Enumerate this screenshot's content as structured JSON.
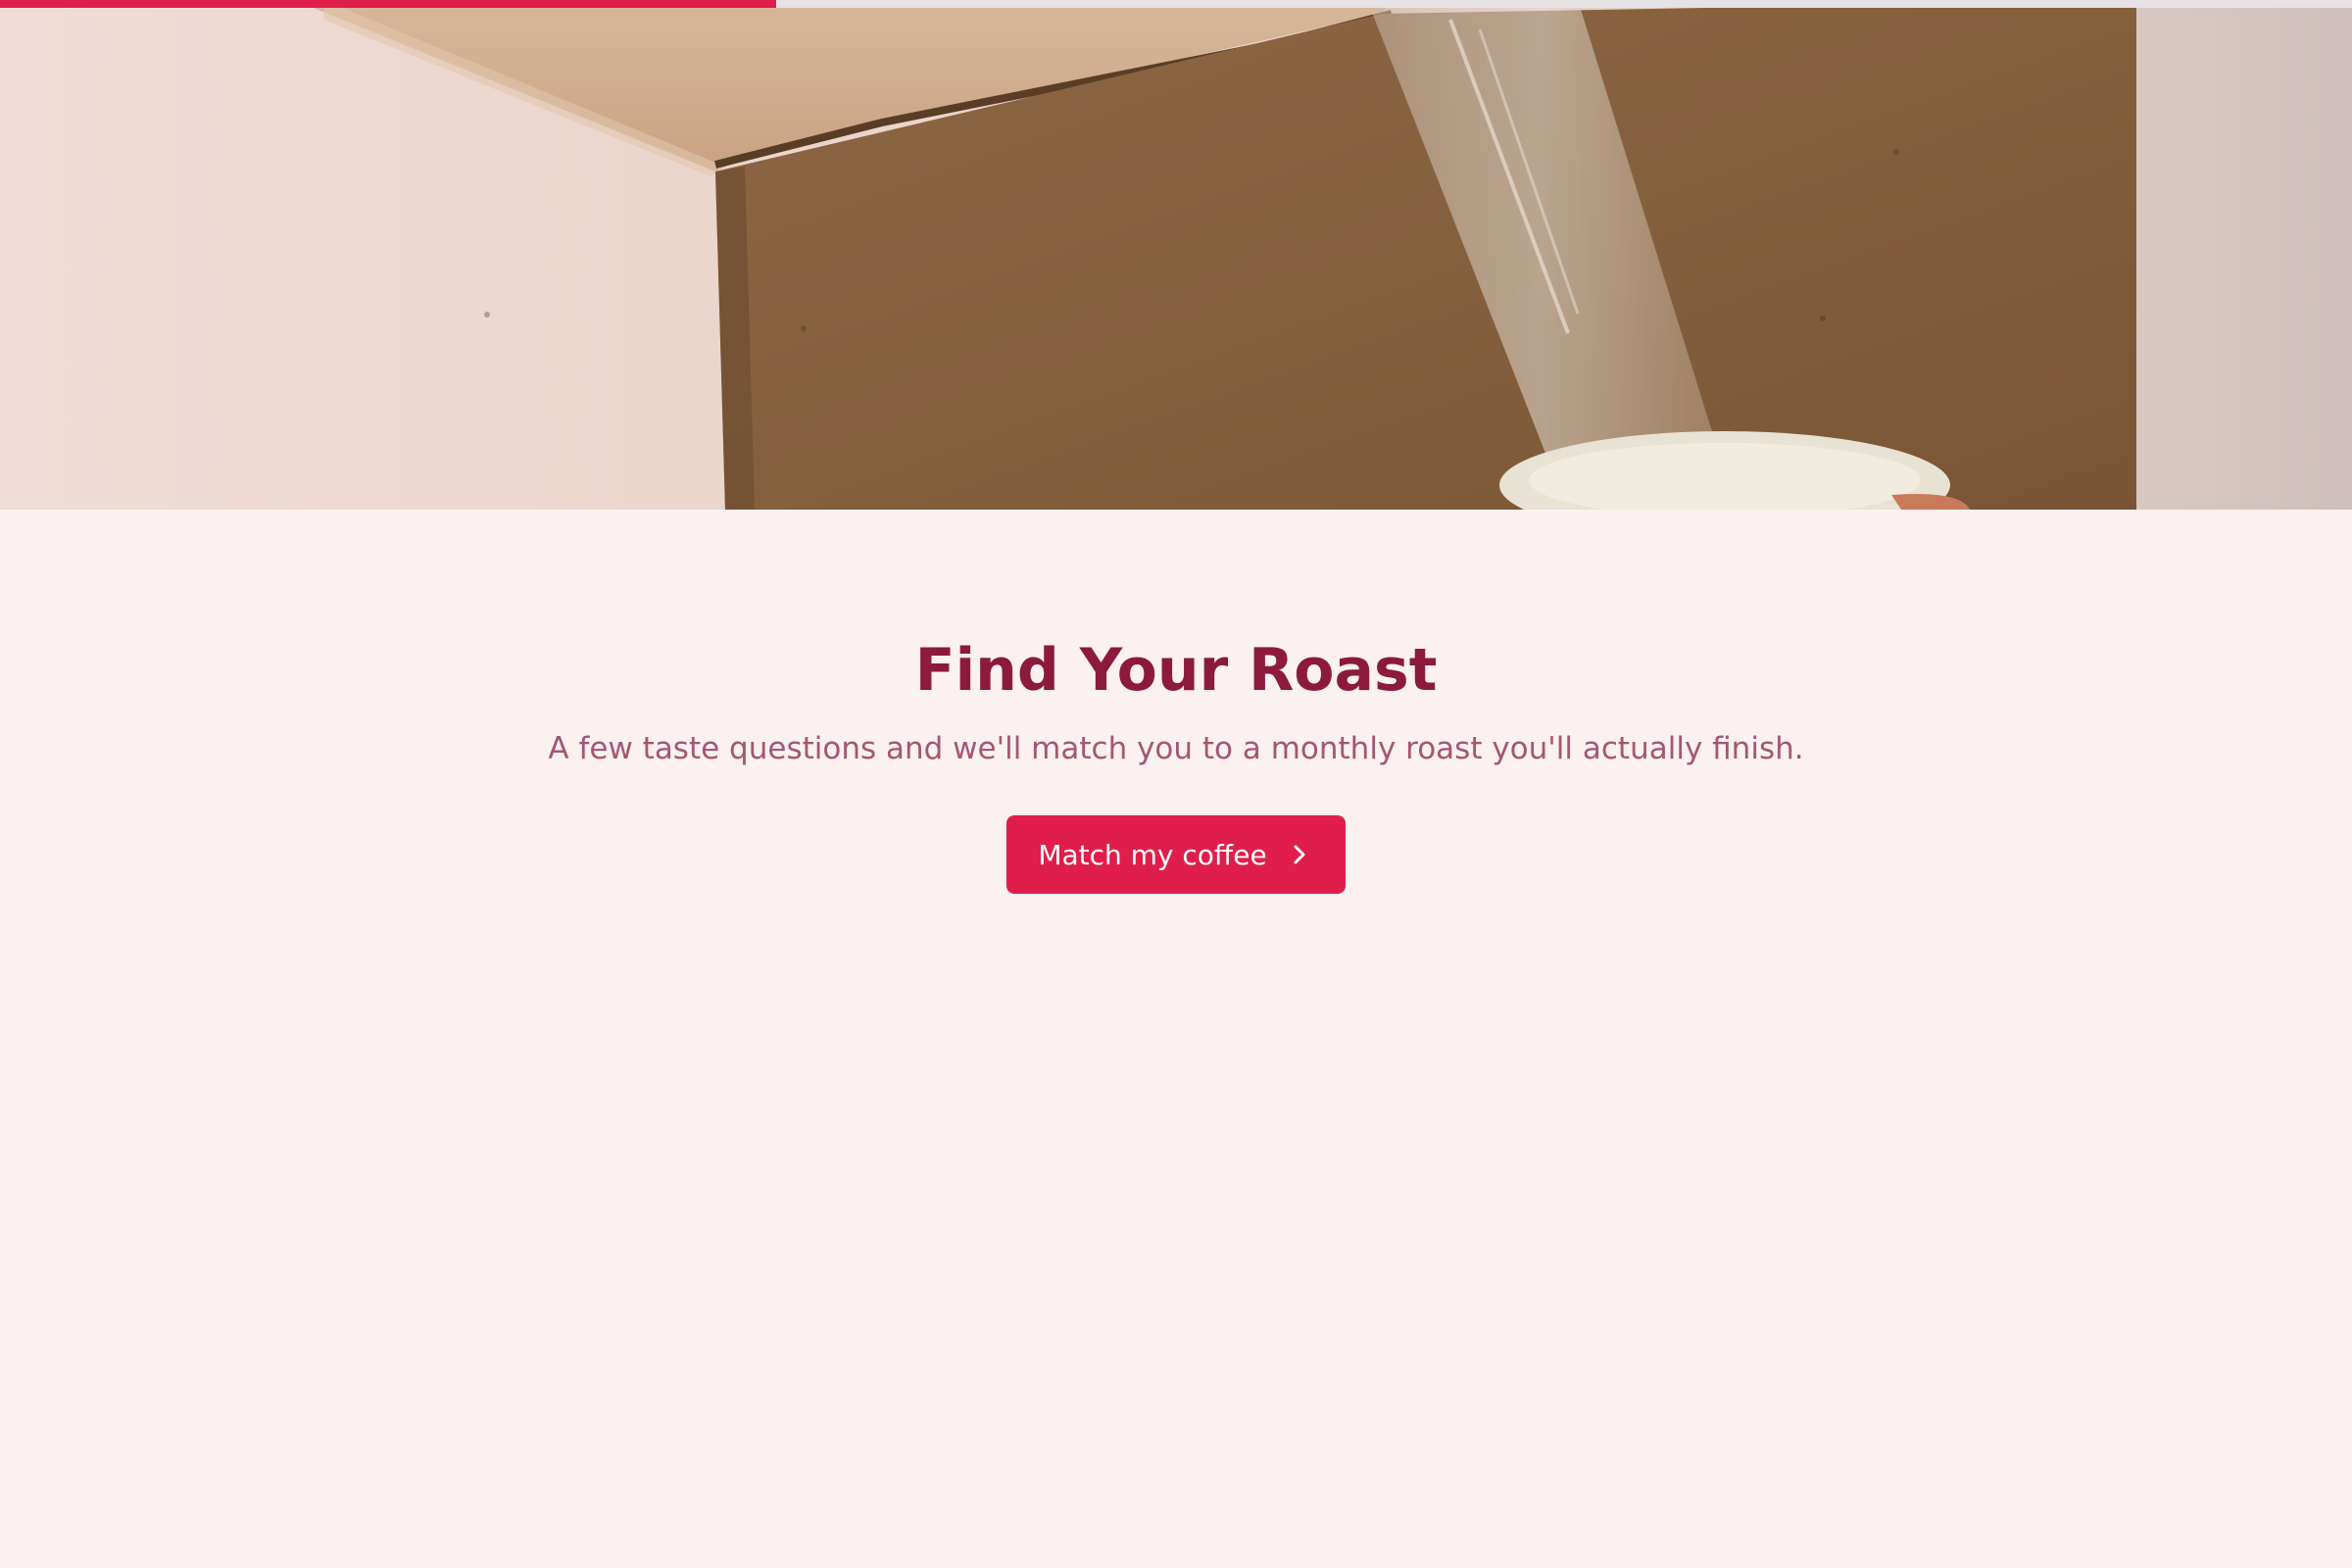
{
  "progress": {
    "value": 0.33,
    "fill_color": "#e01e4b",
    "track_color": "#e6e1e2"
  },
  "hero": {
    "icon": "hero-image",
    "subject": "cardboard box being sealed with packing tape"
  },
  "main": {
    "title": "Find Your Roast",
    "subtitle": "A few taste questions and we'll match you to a monthly roast you'll actually finish.",
    "cta": {
      "label": "Match my coffee",
      "icon": "chevron-right-icon"
    }
  },
  "colors": {
    "background": "#fcf1f1",
    "title": "#8c1a3c",
    "subtitle": "#a45676",
    "accent": "#e01e4b"
  }
}
